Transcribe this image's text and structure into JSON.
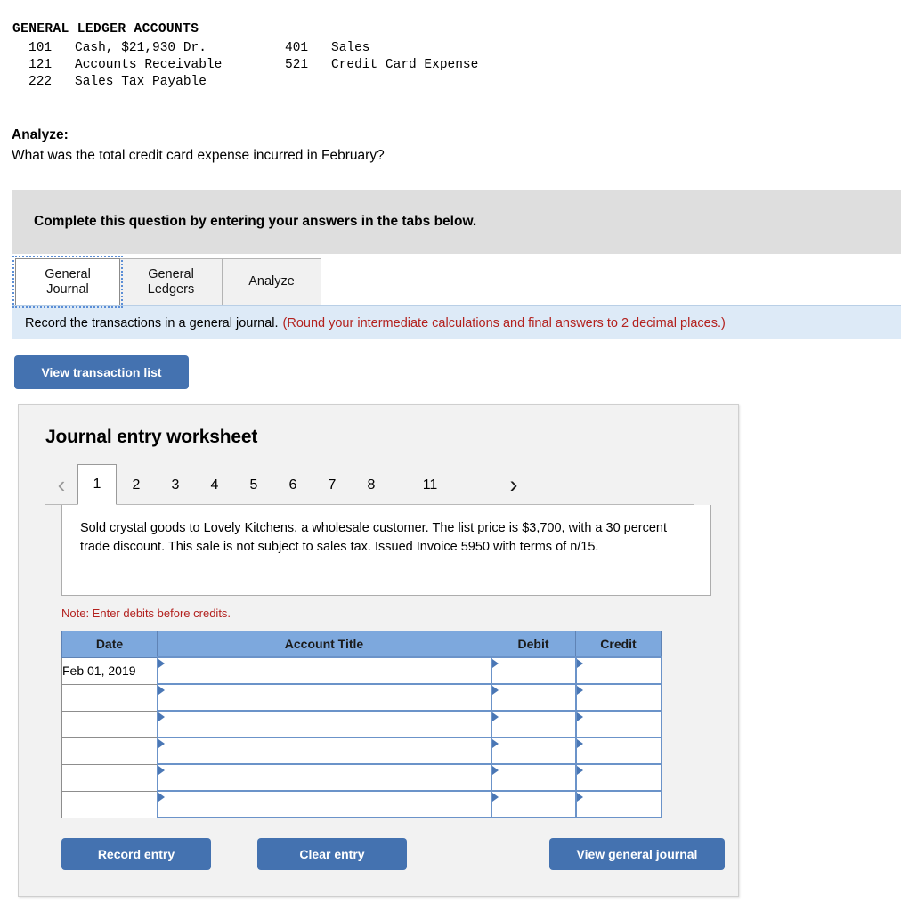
{
  "ledger": {
    "title": "GENERAL LEDGER ACCOUNTS",
    "rows": [
      {
        "left_num": "101",
        "left_name": "Cash, $21,930 Dr.",
        "right_num": "401",
        "right_name": "Sales"
      },
      {
        "left_num": "121",
        "left_name": "Accounts Receivable",
        "right_num": "521",
        "right_name": "Credit Card Expense"
      },
      {
        "left_num": "222",
        "left_name": "Sales Tax Payable",
        "right_num": "",
        "right_name": ""
      }
    ]
  },
  "analyze": {
    "label": "Analyze:",
    "question": "What was the total credit card expense incurred in February?"
  },
  "banner": {
    "text": "Complete this question by entering your answers in the tabs below."
  },
  "tabs": [
    {
      "label": "General\nJournal",
      "line1": "General",
      "line2": "Journal",
      "active": true
    },
    {
      "label": "General Ledgers",
      "line1": "General",
      "line2": "Ledgers",
      "active": false
    },
    {
      "label": "Analyze",
      "line1": "Analyze",
      "line2": "",
      "active": false
    }
  ],
  "instruction": {
    "main": "Record the transactions in a general journal.",
    "note": "(Round your intermediate calculations and final answers to 2 decimal places.)"
  },
  "toolbar": {
    "view_transaction_list": "View transaction list"
  },
  "worksheet": {
    "title": "Journal entry worksheet",
    "pager": {
      "prev_icon": "chevron-left-icon",
      "next_icon": "chevron-right-icon",
      "prev_glyph": "‹",
      "next_glyph": "›",
      "pages": [
        "1",
        "2",
        "3",
        "4",
        "5",
        "6",
        "7",
        "8",
        "11"
      ],
      "active_page": "1"
    },
    "description": "Sold crystal goods to Lovely Kitchens, a wholesale customer. The list price is $3,700, with a 30 percent trade discount. This sale is not subject to sales tax. Issued Invoice 5950 with terms of n/15.",
    "note": "Note: Enter debits before credits.",
    "table": {
      "columns": [
        "Date",
        "Account Title",
        "Debit",
        "Credit"
      ],
      "rows": [
        {
          "date": "Feb 01, 2019",
          "account_title": "",
          "debit": "",
          "credit": ""
        },
        {
          "date": "",
          "account_title": "",
          "debit": "",
          "credit": ""
        },
        {
          "date": "",
          "account_title": "",
          "debit": "",
          "credit": ""
        },
        {
          "date": "",
          "account_title": "",
          "debit": "",
          "credit": ""
        },
        {
          "date": "",
          "account_title": "",
          "debit": "",
          "credit": ""
        },
        {
          "date": "",
          "account_title": "",
          "debit": "",
          "credit": ""
        }
      ]
    },
    "buttons": {
      "record_entry": "Record entry",
      "clear_entry": "Clear entry",
      "view_general_journal": "View general journal"
    }
  },
  "colors": {
    "button_blue": "#4472b0",
    "table_header_blue": "#7da8dd",
    "cell_border_blue": "#6b93c9",
    "banner_gray": "#dedede",
    "strip_blue": "#ddeaf7",
    "note_red": "#b3211e",
    "panel_gray": "#f2f2f2"
  }
}
